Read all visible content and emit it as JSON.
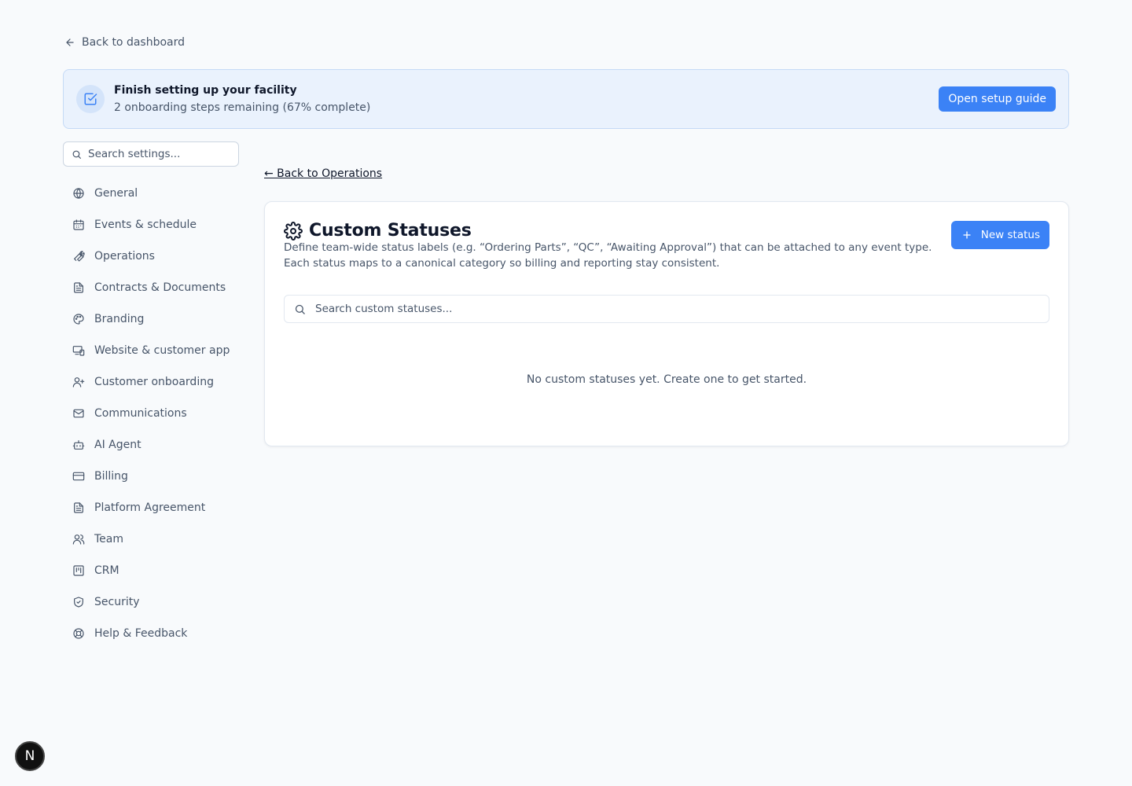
{
  "header": {
    "back_to_dashboard": "Back to dashboard"
  },
  "banner": {
    "title": "Finish setting up your facility",
    "subtitle": "2 onboarding steps remaining (67% complete)",
    "button_label": "Open setup guide"
  },
  "sidebar": {
    "search_placeholder": "Search settings...",
    "items": [
      {
        "label": "General",
        "icon": "globe-icon"
      },
      {
        "label": "Events & schedule",
        "icon": "calendar-icon"
      },
      {
        "label": "Operations",
        "icon": "wrench-icon"
      },
      {
        "label": "Contracts & Documents",
        "icon": "file-text-icon"
      },
      {
        "label": "Branding",
        "icon": "palette-icon"
      },
      {
        "label": "Website & customer app",
        "icon": "devices-icon"
      },
      {
        "label": "Customer onboarding",
        "icon": "user-plus-icon"
      },
      {
        "label": "Communications",
        "icon": "mail-icon"
      },
      {
        "label": "AI Agent",
        "icon": "bot-icon"
      },
      {
        "label": "Billing",
        "icon": "credit-card-icon"
      },
      {
        "label": "Platform Agreement",
        "icon": "file-text-icon"
      },
      {
        "label": "Team",
        "icon": "users-icon"
      },
      {
        "label": "CRM",
        "icon": "kanban-icon"
      },
      {
        "label": "Security",
        "icon": "shield-check-icon"
      },
      {
        "label": "Help & Feedback",
        "icon": "life-buoy-icon"
      }
    ]
  },
  "main": {
    "back_link": "← Back to Operations",
    "title": "Custom Statuses",
    "description": "Define team-wide status labels (e.g. “Ordering Parts”, “QC”, “Awaiting Approval”) that can be attached to any event type. Each status maps to a canonical category so billing and reporting stay consistent.",
    "new_button_label": "New status",
    "search_placeholder": "Search custom statuses...",
    "empty_message": "No custom statuses yet. Create one to get started."
  },
  "fab": {
    "label": "N"
  },
  "colors": {
    "accent": "#3b82f6",
    "banner_bg": "#eaf2fd",
    "text_muted": "#475569"
  }
}
